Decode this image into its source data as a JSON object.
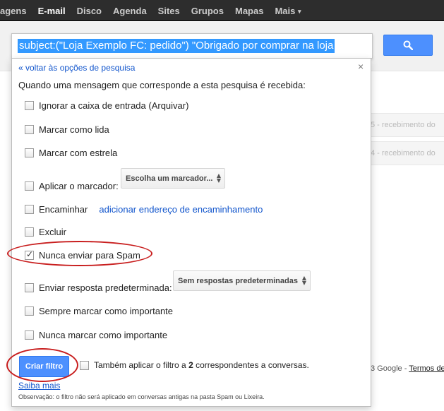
{
  "nav": {
    "items": [
      {
        "label": "agens",
        "active": false
      },
      {
        "label": "E-mail",
        "active": true
      },
      {
        "label": "Disco",
        "active": false
      },
      {
        "label": "Agenda",
        "active": false
      },
      {
        "label": "Sites",
        "active": false
      },
      {
        "label": "Grupos",
        "active": false
      },
      {
        "label": "Mapas",
        "active": false
      },
      {
        "label": "Mais",
        "active": false
      }
    ]
  },
  "search": {
    "value": "subject:(\"Loja Exemplo FC: pedido\") \"Obrigado por comprar na loja",
    "button_icon": "search-icon"
  },
  "background": {
    "row1_text": "5 - recebimento do",
    "row2_text": "4 - recebimento do",
    "footer_text": "3 Google - ",
    "footer_link": "Termos de"
  },
  "filter": {
    "back_link": "« voltar às opções de pesquisa",
    "close": "×",
    "intro": "Quando uma mensagem que corresponde a esta pesquisa é recebida:",
    "options": {
      "skip_inbox": "Ignorar a caixa de entrada (Arquivar)",
      "mark_read": "Marcar como lida",
      "star": "Marcar com estrela",
      "apply_label": "Aplicar o marcador:",
      "label_select": "Escolha um marcador...",
      "forward": "Encaminhar",
      "forward_link": "adicionar endereço de encaminhamento",
      "delete": "Excluir",
      "never_spam": "Nunca enviar para Spam",
      "canned_response": "Enviar resposta predeterminada:",
      "canned_select": "Sem respostas predeterminadas",
      "always_important": "Sempre marcar como importante",
      "never_important": "Nunca marcar como importante"
    },
    "never_spam_checked": true,
    "create_button": "Criar filtro",
    "also_apply_prefix": "Também aplicar o filtro a ",
    "also_apply_count": "2",
    "also_apply_suffix": " correspondentes a conversas.",
    "learn_more": "Saiba mais",
    "note": "Observação: o filtro não será aplicado em conversas antigas na pasta Spam ou Lixeira."
  },
  "colors": {
    "accent_blue": "#4d90fe",
    "link_blue": "#1155cc",
    "annotation_red": "#c81e1e"
  }
}
